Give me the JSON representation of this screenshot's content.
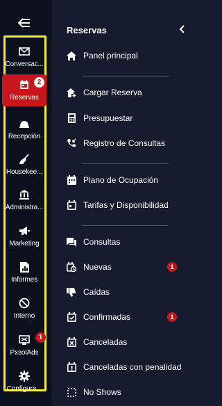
{
  "rail": {
    "items": [
      {
        "label": "Conversac...",
        "icon": "mail-icon"
      },
      {
        "label": "Reservas",
        "icon": "calendar-icon",
        "badge": "2",
        "active": true
      },
      {
        "label": "Recepción",
        "icon": "bell-icon"
      },
      {
        "label": "Housekee...",
        "icon": "broom-icon"
      },
      {
        "label": "Administra...",
        "icon": "bank-icon"
      },
      {
        "label": "Marketing",
        "icon": "megaphone-icon"
      },
      {
        "label": "Informes",
        "icon": "report-icon"
      },
      {
        "label": "Interno",
        "icon": "block-icon"
      },
      {
        "label": "PxsolAds",
        "icon": "ads-icon",
        "badge": "1"
      },
      {
        "label": "Configura...",
        "icon": "gear-icon"
      }
    ]
  },
  "panel": {
    "title": "Reservas",
    "items": [
      {
        "label": "Panel principal",
        "icon": "home-icon"
      },
      {
        "label": "Cargar Reserva",
        "icon": "home-add-icon"
      },
      {
        "label": "Presupuestar",
        "icon": "calculator-icon"
      },
      {
        "label": "Registro de Consultas",
        "icon": "phone-incoming-icon"
      },
      {
        "label": "Plano de Ocupación",
        "icon": "calendar-grid-icon"
      },
      {
        "label": "Tarifas y Disponibilidad",
        "icon": "calendar-icon"
      },
      {
        "label": "Consultas",
        "icon": "chat-icon"
      },
      {
        "label": "Nuevas",
        "icon": "calendar-clock-icon",
        "badge": "1"
      },
      {
        "label": "Caídas",
        "icon": "thumb-down-icon"
      },
      {
        "label": "Confirmadas",
        "icon": "calendar-check-icon",
        "badge": "1"
      },
      {
        "label": "Canceladas",
        "icon": "calendar-x-icon"
      },
      {
        "label": "Canceladas con penalidad",
        "icon": "calendar-penalty-icon"
      },
      {
        "label": "No Shows",
        "icon": "dashed-square-icon"
      }
    ]
  },
  "colors": {
    "background": "#161b2e",
    "rail": "#0c0f1c",
    "accent": "#c8161d",
    "frame": "#f3ea2e"
  }
}
